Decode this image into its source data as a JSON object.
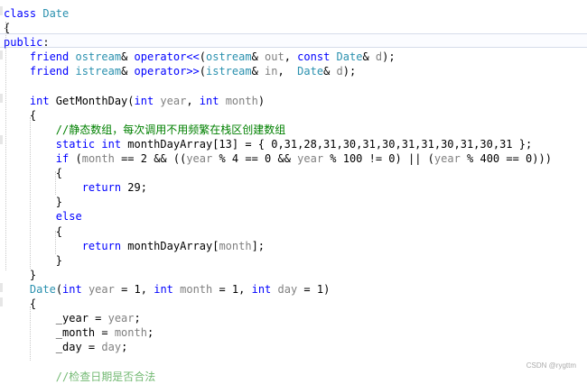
{
  "editor": {
    "lines": [
      [
        {
          "t": "class ",
          "c": "kw"
        },
        {
          "t": "Date",
          "c": "cl"
        }
      ],
      [
        {
          "t": "{",
          "c": ""
        }
      ],
      [
        {
          "t": "public",
          "c": "kw"
        },
        {
          "t": ":",
          "c": ""
        }
      ],
      [
        {
          "t": "    friend ",
          "c": "kw"
        },
        {
          "t": "ostream",
          "c": "ty"
        },
        {
          "t": "& ",
          "c": ""
        },
        {
          "t": "operator<<",
          "c": "kw"
        },
        {
          "t": "(",
          "c": ""
        },
        {
          "t": "ostream",
          "c": "ty"
        },
        {
          "t": "& ",
          "c": ""
        },
        {
          "t": "out",
          "c": "pm"
        },
        {
          "t": ", ",
          "c": ""
        },
        {
          "t": "const ",
          "c": "kw"
        },
        {
          "t": "Date",
          "c": "ty"
        },
        {
          "t": "& ",
          "c": ""
        },
        {
          "t": "d",
          "c": "pm"
        },
        {
          "t": ");",
          "c": ""
        }
      ],
      [
        {
          "t": "    friend ",
          "c": "kw"
        },
        {
          "t": "istream",
          "c": "ty"
        },
        {
          "t": "& ",
          "c": ""
        },
        {
          "t": "operator>>",
          "c": "kw"
        },
        {
          "t": "(",
          "c": ""
        },
        {
          "t": "istream",
          "c": "ty"
        },
        {
          "t": "& ",
          "c": ""
        },
        {
          "t": "in",
          "c": "pm"
        },
        {
          "t": ",  ",
          "c": ""
        },
        {
          "t": "Date",
          "c": "ty"
        },
        {
          "t": "& ",
          "c": ""
        },
        {
          "t": "d",
          "c": "pm"
        },
        {
          "t": ");",
          "c": ""
        }
      ],
      [
        {
          "t": "",
          "c": ""
        }
      ],
      [
        {
          "t": "    int ",
          "c": "kw"
        },
        {
          "t": "GetMonthDay",
          "c": ""
        },
        {
          "t": "(",
          "c": ""
        },
        {
          "t": "int ",
          "c": "kw"
        },
        {
          "t": "year",
          "c": "pm"
        },
        {
          "t": ", ",
          "c": ""
        },
        {
          "t": "int ",
          "c": "kw"
        },
        {
          "t": "month",
          "c": "pm"
        },
        {
          "t": ")",
          "c": ""
        }
      ],
      [
        {
          "t": "    {",
          "c": ""
        }
      ],
      [
        {
          "t": "        //静态数组，每次调用不用频繁在栈区创建数组",
          "c": "cm"
        }
      ],
      [
        {
          "t": "        static ",
          "c": "kw"
        },
        {
          "t": "int ",
          "c": "kw"
        },
        {
          "t": "monthDayArray[13] = { 0,31,28,31,30,31,30,31,31,30,31,30,31 };",
          "c": ""
        }
      ],
      [
        {
          "t": "        if ",
          "c": "kw"
        },
        {
          "t": "(",
          "c": ""
        },
        {
          "t": "month",
          "c": "pm"
        },
        {
          "t": " == 2 && ((",
          "c": ""
        },
        {
          "t": "year",
          "c": "pm"
        },
        {
          "t": " % 4 == 0 && ",
          "c": ""
        },
        {
          "t": "year",
          "c": "pm"
        },
        {
          "t": " % 100 != 0) || (",
          "c": ""
        },
        {
          "t": "year",
          "c": "pm"
        },
        {
          "t": " % 400 == 0)))",
          "c": ""
        }
      ],
      [
        {
          "t": "        {",
          "c": ""
        }
      ],
      [
        {
          "t": "            return ",
          "c": "kw"
        },
        {
          "t": "29;",
          "c": ""
        }
      ],
      [
        {
          "t": "        }",
          "c": ""
        }
      ],
      [
        {
          "t": "        else",
          "c": "kw"
        }
      ],
      [
        {
          "t": "        {",
          "c": ""
        }
      ],
      [
        {
          "t": "            return ",
          "c": "kw"
        },
        {
          "t": "monthDayArray[",
          "c": ""
        },
        {
          "t": "month",
          "c": "pm"
        },
        {
          "t": "];",
          "c": ""
        }
      ],
      [
        {
          "t": "        }",
          "c": ""
        }
      ],
      [
        {
          "t": "    }",
          "c": ""
        }
      ],
      [
        {
          "t": "    ",
          "c": ""
        },
        {
          "t": "Date",
          "c": "ty"
        },
        {
          "t": "(",
          "c": ""
        },
        {
          "t": "int ",
          "c": "kw"
        },
        {
          "t": "year",
          "c": "pm"
        },
        {
          "t": " = 1, ",
          "c": ""
        },
        {
          "t": "int ",
          "c": "kw"
        },
        {
          "t": "month",
          "c": "pm"
        },
        {
          "t": " = 1, ",
          "c": ""
        },
        {
          "t": "int ",
          "c": "kw"
        },
        {
          "t": "day",
          "c": "pm"
        },
        {
          "t": " = 1)",
          "c": ""
        }
      ],
      [
        {
          "t": "    {",
          "c": ""
        }
      ],
      [
        {
          "t": "        _year = ",
          "c": ""
        },
        {
          "t": "year",
          "c": "pm"
        },
        {
          "t": ";",
          "c": ""
        }
      ],
      [
        {
          "t": "        _month = ",
          "c": ""
        },
        {
          "t": "month",
          "c": "pm"
        },
        {
          "t": ";",
          "c": ""
        }
      ],
      [
        {
          "t": "        _day = ",
          "c": ""
        },
        {
          "t": "day",
          "c": "pm"
        },
        {
          "t": ";",
          "c": ""
        }
      ],
      [
        {
          "t": "",
          "c": ""
        }
      ],
      [
        {
          "t": "        //检查日期是否合法",
          "c": "partial"
        }
      ]
    ]
  },
  "watermark": "CSDN @rygttm"
}
